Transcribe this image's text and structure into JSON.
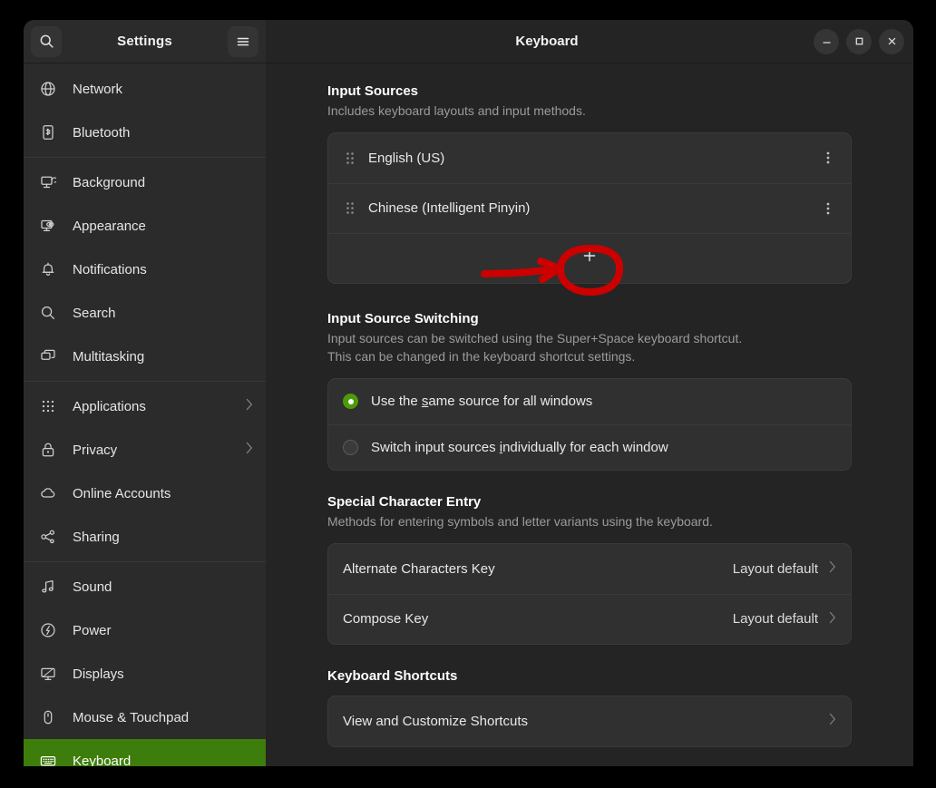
{
  "window": {
    "app_title": "Settings",
    "page_title": "Keyboard",
    "search_icon": "search-icon",
    "menu_icon": "hamburger-menu-icon",
    "minimize_label": "Minimize",
    "maximize_label": "Maximize",
    "close_label": "Close",
    "accent_color": "#3d7d0b",
    "radio_accent": "#4e9a0b",
    "annotation_color": "#cc0000"
  },
  "sidebar": {
    "items": [
      {
        "label": "Network",
        "icon": "globe-icon",
        "chevron": false,
        "selected": false,
        "sep_after": false
      },
      {
        "label": "Bluetooth",
        "icon": "bluetooth-icon",
        "chevron": false,
        "selected": false,
        "sep_after": true
      },
      {
        "label": "Background",
        "icon": "background-icon",
        "chevron": false,
        "selected": false,
        "sep_after": false
      },
      {
        "label": "Appearance",
        "icon": "appearance-icon",
        "chevron": false,
        "selected": false,
        "sep_after": false
      },
      {
        "label": "Notifications",
        "icon": "bell-icon",
        "chevron": false,
        "selected": false,
        "sep_after": false
      },
      {
        "label": "Search",
        "icon": "search-icon",
        "chevron": false,
        "selected": false,
        "sep_after": false
      },
      {
        "label": "Multitasking",
        "icon": "multitasking-icon",
        "chevron": false,
        "selected": false,
        "sep_after": true
      },
      {
        "label": "Applications",
        "icon": "grid-dots-icon",
        "chevron": true,
        "selected": false,
        "sep_after": false
      },
      {
        "label": "Privacy",
        "icon": "lock-icon",
        "chevron": true,
        "selected": false,
        "sep_after": false
      },
      {
        "label": "Online Accounts",
        "icon": "cloud-icon",
        "chevron": false,
        "selected": false,
        "sep_after": false
      },
      {
        "label": "Sharing",
        "icon": "share-icon",
        "chevron": false,
        "selected": false,
        "sep_after": true
      },
      {
        "label": "Sound",
        "icon": "music-note-icon",
        "chevron": false,
        "selected": false,
        "sep_after": false
      },
      {
        "label": "Power",
        "icon": "power-icon",
        "chevron": false,
        "selected": false,
        "sep_after": false
      },
      {
        "label": "Displays",
        "icon": "display-icon",
        "chevron": false,
        "selected": false,
        "sep_after": false
      },
      {
        "label": "Mouse & Touchpad",
        "icon": "mouse-icon",
        "chevron": false,
        "selected": false,
        "sep_after": false
      },
      {
        "label": "Keyboard",
        "icon": "keyboard-icon",
        "chevron": false,
        "selected": true,
        "sep_after": false
      }
    ]
  },
  "main": {
    "input_sources": {
      "title": "Input Sources",
      "description": "Includes keyboard layouts and input methods.",
      "sources": [
        {
          "name": "English (US)",
          "grip_icon": "drag-handle-icon",
          "menu_icon": "kebab-menu-icon"
        },
        {
          "name": "Chinese (Intelligent Pinyin)",
          "grip_icon": "drag-handle-icon",
          "menu_icon": "kebab-menu-icon"
        }
      ],
      "add_icon": "plus-icon",
      "add_label": "Add Input Source"
    },
    "input_source_switching": {
      "title": "Input Source Switching",
      "description": "Input sources can be switched using the Super+Space keyboard shortcut.\nThis can be changed in the keyboard shortcut settings.",
      "options": [
        {
          "label_before": "Use the ",
          "mnemonic": "s",
          "label_after": "ame source for all windows",
          "selected": true
        },
        {
          "label_before": "Switch input sources ",
          "mnemonic": "i",
          "label_after": "ndividually for each window",
          "selected": false
        }
      ]
    },
    "special_character_entry": {
      "title": "Special Character Entry",
      "description": "Methods for entering symbols and letter variants using the keyboard.",
      "rows": [
        {
          "label": "Alternate Characters Key",
          "value": "Layout default",
          "chevron_icon": "chevron-right-icon"
        },
        {
          "label": "Compose Key",
          "value": "Layout default",
          "chevron_icon": "chevron-right-icon"
        }
      ]
    },
    "keyboard_shortcuts": {
      "title": "Keyboard Shortcuts",
      "rows": [
        {
          "label": "View and Customize Shortcuts",
          "value": "",
          "chevron_icon": "chevron-right-icon"
        }
      ]
    }
  },
  "annotation": {
    "type": "hand-drawn-highlight",
    "shape": "circle-with-arrow",
    "target": "add-input-source-button",
    "color": "#cc0000"
  }
}
